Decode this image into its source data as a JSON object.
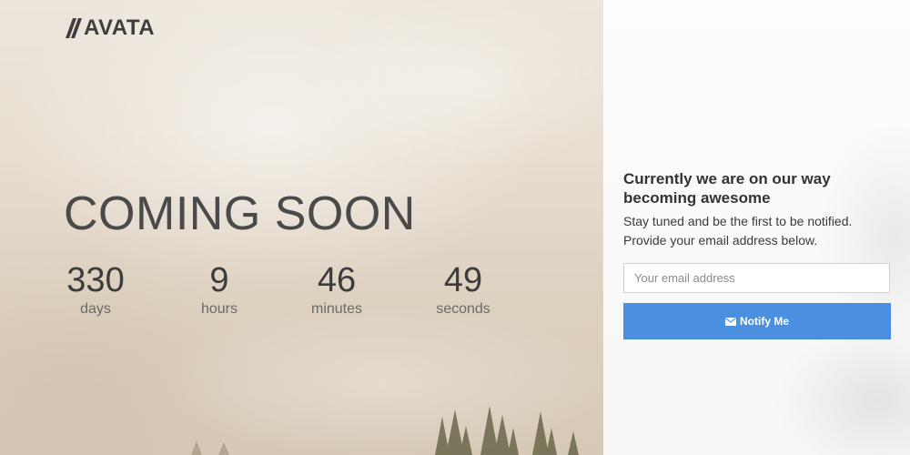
{
  "brand": {
    "logo_text": "AVATA",
    "logo_icon": "slash-stripes-icon"
  },
  "hero": {
    "title": "COMING SOON"
  },
  "countdown": {
    "days": {
      "value": "330",
      "label": "days"
    },
    "hours": {
      "value": "9",
      "label": "hours"
    },
    "minutes": {
      "value": "46",
      "label": "minutes"
    },
    "seconds": {
      "value": "49",
      "label": "seconds"
    }
  },
  "signup": {
    "headline": "Currently we are on our way becoming awesome",
    "subtext": "Stay tuned and be the first to be notified. Provide your email address below.",
    "email_placeholder": "Your email address",
    "email_value": "",
    "button_label": "Notify Me",
    "button_icon": "envelope-icon"
  },
  "colors": {
    "accent": "#4a8fe0",
    "text_dark": "#333333",
    "hero_text": "#4a4a4a"
  }
}
